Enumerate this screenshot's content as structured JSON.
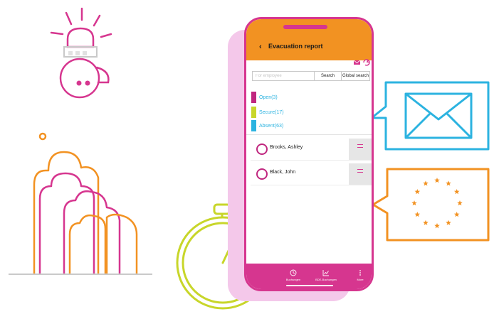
{
  "screen": {
    "title": "Evacuation report",
    "back_label": "‹"
  },
  "search": {
    "placeholder": "For employee",
    "value": "",
    "search_label": "Search",
    "global_search_label": "Global search"
  },
  "status_groups": [
    {
      "label": "Open(3)",
      "color": "#c0277f"
    },
    {
      "label": "Secure(17)",
      "color": "#c8d62a"
    },
    {
      "label": "Absent(63)",
      "color": "#2cb3e0"
    }
  ],
  "employees": [
    {
      "name": "Brooks, Ashley"
    },
    {
      "name": "Black, John"
    }
  ],
  "tab_bar": {
    "items": [
      {
        "label": "Buchungen",
        "icon": "clock-icon"
      },
      {
        "label": "BDE-Buchungen",
        "icon": "chart-icon"
      },
      {
        "label": "More",
        "icon": "more-dots-icon"
      }
    ]
  },
  "colors": {
    "header": "#f29222",
    "accent": "#d6368f",
    "secure": "#c8d62a",
    "absent": "#2cb3e0",
    "email_card": "#2cb3e0",
    "eu_card": "#f29222",
    "stopwatch": "#c8d62a"
  },
  "decorations": {
    "alarm": "siren-icon",
    "crowd": "people-icon",
    "stopwatch": "stopwatch-icon",
    "email_card": "envelope-icon",
    "eu_card": "eu-stars-icon"
  }
}
